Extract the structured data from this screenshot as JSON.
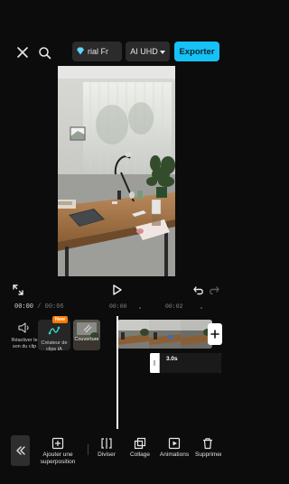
{
  "header": {
    "trial_label": "rial  Fr",
    "quality_label": "AI UHD",
    "export_label": "Exporter"
  },
  "timeline": {
    "current_time": "00:00",
    "separator": " / ",
    "total_time": "00:06",
    "ruler_ticks": [
      "00:00",
      "00:02"
    ],
    "tools": {
      "audio_label": "Réactiver le son du clip",
      "ai_label": "Créateur de clips IA",
      "new_badge": "New",
      "cover_label": "Couverture"
    },
    "overlay_duration": "3.0s"
  },
  "toolbar": {
    "items": [
      {
        "label": "Ajouter une superposition",
        "icon": "add-overlay-icon"
      },
      {
        "label": "Diviser",
        "icon": "split-icon"
      },
      {
        "label": "Collage",
        "icon": "collage-icon"
      },
      {
        "label": "Animations",
        "icon": "animations-icon"
      },
      {
        "label": "Supprimer",
        "icon": "trash-icon"
      }
    ]
  },
  "colors": {
    "accent": "#16c1f5",
    "new_badge": "#ff7a00",
    "background": "#0c0c0c"
  }
}
